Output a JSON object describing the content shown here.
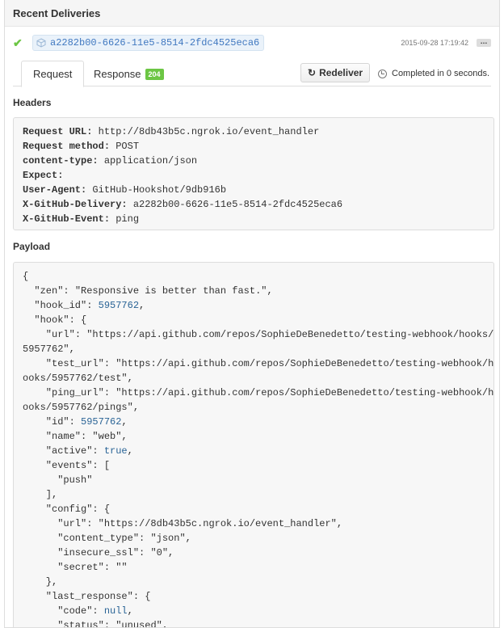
{
  "panel": {
    "title": "Recent Deliveries"
  },
  "delivery": {
    "status_icon": "check-icon",
    "guid_icon": "cube-icon",
    "guid": "a2282b00-6626-11e5-8514-2fdc4525eca6",
    "timestamp": "2015-09-28 17:19:42",
    "more_label": "…"
  },
  "tabs": {
    "request": "Request",
    "response": "Response",
    "response_code": "204"
  },
  "actions": {
    "redeliver_icon": "sync-icon",
    "redeliver_label": "Redeliver",
    "completed_icon": "clock-icon",
    "completed_text": "Completed in 0 seconds."
  },
  "headers": {
    "title": "Headers",
    "lines": [
      {
        "key": "Request URL:",
        "value": "http://8db43b5c.ngrok.io/event_handler"
      },
      {
        "key": "Request method:",
        "value": "POST"
      },
      {
        "key": "content-type:",
        "value": "application/json"
      },
      {
        "key": "Expect:",
        "value": ""
      },
      {
        "key": "User-Agent:",
        "value": "GitHub-Hookshot/9db916b"
      },
      {
        "key": "X-GitHub-Delivery:",
        "value": "a2282b00-6626-11e5-8514-2fdc4525eca6"
      },
      {
        "key": "X-GitHub-Event:",
        "value": "ping"
      }
    ]
  },
  "payload": {
    "title": "Payload",
    "lines": [
      [
        {
          "t": "{",
          "c": "p"
        }
      ],
      [
        {
          "t": "  \"zen\"",
          "c": "k"
        },
        {
          "t": ": ",
          "c": "p"
        },
        {
          "t": "\"Responsive is better than fast.\"",
          "c": "s"
        },
        {
          "t": ",",
          "c": "p"
        }
      ],
      [
        {
          "t": "  \"hook_id\"",
          "c": "k"
        },
        {
          "t": ": ",
          "c": "p"
        },
        {
          "t": "5957762",
          "c": "n"
        },
        {
          "t": ",",
          "c": "p"
        }
      ],
      [
        {
          "t": "  \"hook\"",
          "c": "k"
        },
        {
          "t": ": {",
          "c": "p"
        }
      ],
      [
        {
          "t": "    \"url\"",
          "c": "k"
        },
        {
          "t": ": ",
          "c": "p"
        },
        {
          "t": "\"https://api.github.com/repos/SophieDeBenedetto/testing-webhook/hooks/",
          "c": "s"
        }
      ],
      [
        {
          "t": "5957762\"",
          "c": "s"
        },
        {
          "t": ",",
          "c": "p"
        }
      ],
      [
        {
          "t": "    \"test_url\"",
          "c": "k"
        },
        {
          "t": ": ",
          "c": "p"
        },
        {
          "t": "\"https://api.github.com/repos/SophieDeBenedetto/testing-webhook/h",
          "c": "s"
        }
      ],
      [
        {
          "t": "ooks/5957762/test\"",
          "c": "s"
        },
        {
          "t": ",",
          "c": "p"
        }
      ],
      [
        {
          "t": "    \"ping_url\"",
          "c": "k"
        },
        {
          "t": ": ",
          "c": "p"
        },
        {
          "t": "\"https://api.github.com/repos/SophieDeBenedetto/testing-webhook/h",
          "c": "s"
        }
      ],
      [
        {
          "t": "ooks/5957762/pings\"",
          "c": "s"
        },
        {
          "t": ",",
          "c": "p"
        }
      ],
      [
        {
          "t": "    \"id\"",
          "c": "k"
        },
        {
          "t": ": ",
          "c": "p"
        },
        {
          "t": "5957762",
          "c": "n"
        },
        {
          "t": ",",
          "c": "p"
        }
      ],
      [
        {
          "t": "    \"name\"",
          "c": "k"
        },
        {
          "t": ": ",
          "c": "p"
        },
        {
          "t": "\"web\"",
          "c": "s"
        },
        {
          "t": ",",
          "c": "p"
        }
      ],
      [
        {
          "t": "    \"active\"",
          "c": "k"
        },
        {
          "t": ": ",
          "c": "p"
        },
        {
          "t": "true",
          "c": "b"
        },
        {
          "t": ",",
          "c": "p"
        }
      ],
      [
        {
          "t": "    \"events\"",
          "c": "k"
        },
        {
          "t": ": [",
          "c": "p"
        }
      ],
      [
        {
          "t": "      \"push\"",
          "c": "s"
        }
      ],
      [
        {
          "t": "    ],",
          "c": "p"
        }
      ],
      [
        {
          "t": "    \"config\"",
          "c": "k"
        },
        {
          "t": ": {",
          "c": "p"
        }
      ],
      [
        {
          "t": "      \"url\"",
          "c": "k"
        },
        {
          "t": ": ",
          "c": "p"
        },
        {
          "t": "\"https://8db43b5c.ngrok.io/event_handler\"",
          "c": "s"
        },
        {
          "t": ",",
          "c": "p"
        }
      ],
      [
        {
          "t": "      \"content_type\"",
          "c": "k"
        },
        {
          "t": ": ",
          "c": "p"
        },
        {
          "t": "\"json\"",
          "c": "s"
        },
        {
          "t": ",",
          "c": "p"
        }
      ],
      [
        {
          "t": "      \"insecure_ssl\"",
          "c": "k"
        },
        {
          "t": ": ",
          "c": "p"
        },
        {
          "t": "\"0\"",
          "c": "s"
        },
        {
          "t": ",",
          "c": "p"
        }
      ],
      [
        {
          "t": "      \"secret\"",
          "c": "k"
        },
        {
          "t": ": ",
          "c": "p"
        },
        {
          "t": "\"\"",
          "c": "s"
        }
      ],
      [
        {
          "t": "    },",
          "c": "p"
        }
      ],
      [
        {
          "t": "    \"last_response\"",
          "c": "k"
        },
        {
          "t": ": {",
          "c": "p"
        }
      ],
      [
        {
          "t": "      \"code\"",
          "c": "k"
        },
        {
          "t": ": ",
          "c": "p"
        },
        {
          "t": "null",
          "c": "b"
        },
        {
          "t": ",",
          "c": "p"
        }
      ],
      [
        {
          "t": "      \"status\"",
          "c": "k"
        },
        {
          "t": ": ",
          "c": "p"
        },
        {
          "t": "\"unused\"",
          "c": "s"
        },
        {
          "t": ",",
          "c": "p"
        }
      ]
    ]
  }
}
